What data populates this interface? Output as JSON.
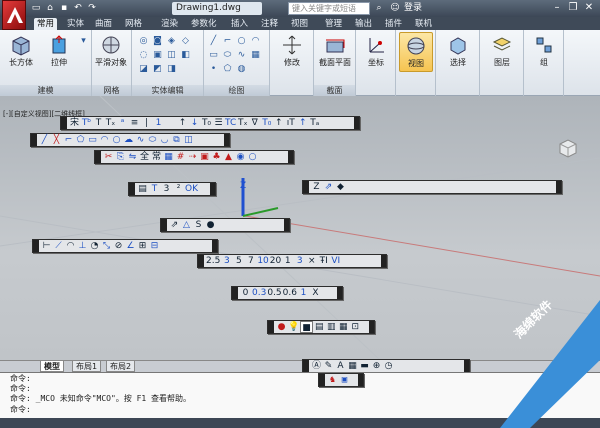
{
  "window": {
    "file_title": "Drawing1.dwg",
    "search_placeholder": "键入关键字或短语",
    "login_label": "登录"
  },
  "ribbon_tabs": [
    "常用",
    "实体",
    "曲面",
    "网格",
    "渲染",
    "参数化",
    "插入",
    "注释",
    "视图",
    "管理",
    "输出",
    "插件",
    "联机"
  ],
  "ribbon": {
    "modeling": {
      "title": "建模",
      "box_label": "长方体",
      "extrude_label": "拉伸"
    },
    "mesh": {
      "title": "网格",
      "smooth_label": "平滑对象"
    },
    "solid_edit": {
      "title": "实体编辑"
    },
    "draw": {
      "title": "绘图"
    },
    "modify": {
      "label": "修改"
    },
    "section": {
      "title": "截面",
      "plane_label": "截面平面"
    },
    "coord": {
      "label": "坐标"
    },
    "view": {
      "label": "视图"
    },
    "select": {
      "label": "选择"
    },
    "layers": {
      "label": "图层"
    },
    "groups": {
      "label": "组"
    }
  },
  "viewport": {
    "label": "[-][自定义视图][二维线框]"
  },
  "toolbars": {
    "tb1": [
      "宋",
      "Tᵇ",
      "T",
      "Tₓ",
      "ᵃ",
      "≡",
      "|",
      "1",
      "",
      "↑",
      "↓",
      "T₀",
      "☰",
      "TC",
      "Tₓ",
      "∇",
      "T₀",
      "↑",
      "ıT",
      "↑",
      "Tₐ"
    ],
    "tb5": [
      "0",
      "0.3",
      "0.5",
      "0.6",
      "1",
      "X"
    ],
    "tb6": [
      "2.5",
      "3",
      "5",
      "7",
      "10",
      "20",
      "1",
      "3",
      "×",
      "ŦI",
      "VI"
    ],
    "tb7": [
      "▤",
      "T",
      "3",
      "²",
      "OK"
    ],
    "tb8": [
      "Z",
      "⇗",
      "◆"
    ],
    "tb9": [
      "⇗",
      "△",
      "S",
      "●"
    ]
  },
  "layout_tabs": [
    "模型",
    "布局1",
    "布局2"
  ],
  "command_lines": [
    "命令:",
    "命令:",
    "命令: _MCO 未知命令\"MCO\"。按 F1 查看帮助。",
    "命令:"
  ],
  "watermark": "海绵软件",
  "colors": {
    "app_red": "#c8201f",
    "ribbon_bg": "#e7ecf1",
    "titlebar": "#47525f"
  }
}
